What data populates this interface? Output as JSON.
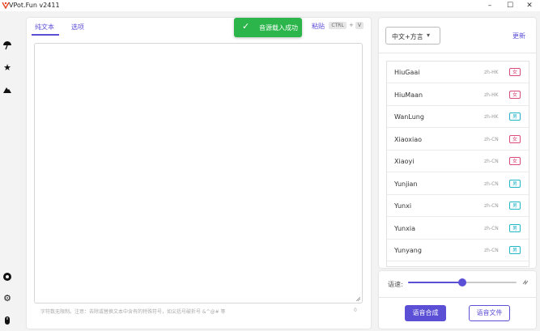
{
  "window": {
    "title": "VPot.Fun v2411",
    "controls": {
      "minimize": "–",
      "maximize": "☐",
      "close": "✕"
    }
  },
  "sidebar": {
    "top_icons": [
      "umbrella-icon",
      "star-icon",
      "mountain-icon"
    ],
    "bottom_icons": [
      "aperture-icon",
      "gear-icon",
      "mouse-icon"
    ]
  },
  "editor": {
    "tabs": [
      {
        "label": "纯文本",
        "active": true
      },
      {
        "label": "选项",
        "active": false
      }
    ],
    "paste_label": "粘贴",
    "paste_shortcut": {
      "key1": "CTRL",
      "plus": "+",
      "key2": "V"
    },
    "text_value": "",
    "hint": "字符数无限制。注意：去除或替换文本中含有的特殊符号，如尖括号破折号 &^@# 等",
    "char_count": "0"
  },
  "toast": {
    "message": "音源载入成功",
    "color": "#2bb54b"
  },
  "voice_panel": {
    "language_select": "中文+方言",
    "refresh_label": "更新",
    "voices": [
      {
        "name": "HiuGaai",
        "locale": "zh-HK",
        "gender": "女"
      },
      {
        "name": "HiuMaan",
        "locale": "zh-HK",
        "gender": "女"
      },
      {
        "name": "WanLung",
        "locale": "zh-HK",
        "gender": "男"
      },
      {
        "name": "Xiaoxiao",
        "locale": "zh-CN",
        "gender": "女"
      },
      {
        "name": "Xiaoyi",
        "locale": "zh-CN",
        "gender": "女"
      },
      {
        "name": "Yunjian",
        "locale": "zh-CN",
        "gender": "男"
      },
      {
        "name": "Yunxi",
        "locale": "zh-CN",
        "gender": "男"
      },
      {
        "name": "Yunxia",
        "locale": "zh-CN",
        "gender": "男"
      },
      {
        "name": "Yunyang",
        "locale": "zh-CN",
        "gender": "男"
      }
    ],
    "colors": {
      "female": "#d94b7a",
      "male": "#22b6c8",
      "accent": "#5b4fd6"
    }
  },
  "speed": {
    "label": "语速:",
    "value_fraction": 0.5,
    "icon": "speed-icon"
  },
  "actions": {
    "synthesize": "语音合成",
    "audio_file": "语音文件"
  }
}
